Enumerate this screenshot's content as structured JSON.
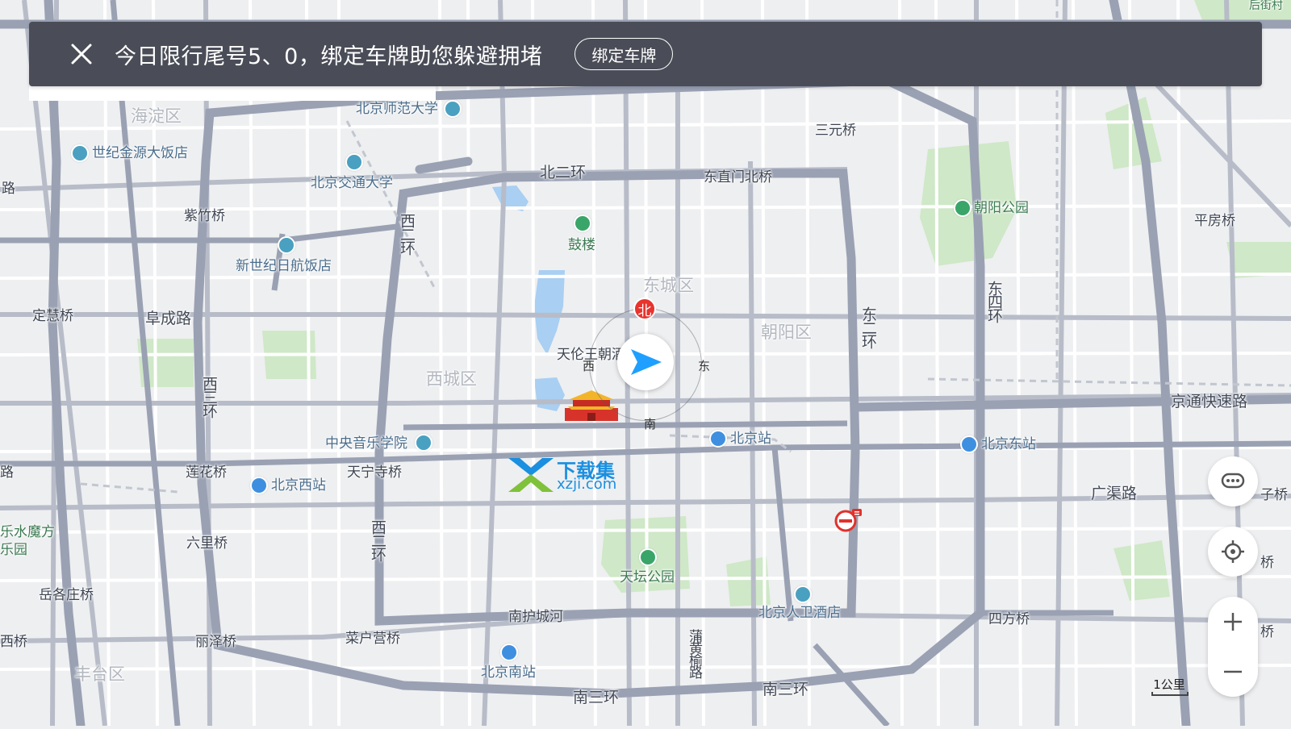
{
  "banner": {
    "message": "今日限行尾号5、0，绑定车牌助您躲避拥堵",
    "bind_button": "绑定车牌"
  },
  "compass": {
    "north": "北",
    "south": "南",
    "east": "东",
    "west": "西"
  },
  "scale": {
    "label": "1公里"
  },
  "watermark": {
    "text": "下载集",
    "domain": "xzji.com"
  },
  "colors": {
    "background": "#eeeff1",
    "road_major": "#9aa1b3",
    "road_minor": "#ffffff",
    "park": "#cfe8c7",
    "water": "#a9cff2",
    "banner": "#4a4d57",
    "navigation_arrow": "#1f9fff",
    "north_badge": "#e8342e"
  },
  "icons": [
    "close-icon",
    "chat-icon",
    "locate-icon",
    "zoom-in-icon",
    "zoom-out-icon",
    "navigation-arrow-icon",
    "tiananmen-icon",
    "no-entry-icon"
  ],
  "districts": [
    "海淀区",
    "东城区",
    "西城区",
    "朝阳区",
    "丰台区"
  ],
  "roads": {
    "bei_er_huan": "北二环",
    "dong_er_huan": "东二环",
    "xi_er_huan_n": "西二环",
    "xi_er_huan_s": "西二环",
    "xi_san_huan": "西三环",
    "dong_si_huan": "东四环",
    "nan_san_huan_l": "南三环",
    "nan_san_huan_r": "南三环",
    "fucheng_lu": "阜成路",
    "guangqu_lu": "广渠路",
    "jingtong": "京通快速路",
    "nanhucheng_he": "南护城河",
    "puhuang_yu": "蒲黄榆路",
    "lu_left": "路",
    "lu_left2": "路"
  },
  "bridges": {
    "sanyuan": "三元桥",
    "dongzhimen": "东直门北桥",
    "zizhu": "紫竹桥",
    "dinghui": "定慧桥",
    "lianhua": "莲花桥",
    "tianning": "天宁寺桥",
    "liuli": "六里桥",
    "yuegezhuang": "岳各庄桥",
    "lize": "丽泽桥",
    "caihuying": "菜户营桥",
    "sifang": "四方桥",
    "pingfang": "平房桥",
    "xi": "西桥",
    "qiao_right": "桥",
    "qiao_right2": "桥",
    "ziqiao_right": "子桥"
  },
  "pois": {
    "bnu": "北京师范大学",
    "shiji": "世纪金源大饭店",
    "bjtu": "北京交通大学",
    "xinshiji": "新世纪日航饭店",
    "gulou": "鼓楼",
    "tianlun": "天伦王朝酒",
    "chaoyang_park": "朝阳公园",
    "ccom": "中央音乐学院",
    "beijing_station": "北京站",
    "beijing_east": "北京东站",
    "beijing_west": "北京西站",
    "tiantan": "天坛公园",
    "renwei": "北京人卫酒店",
    "beijing_south": "北京南站",
    "lemo": "乐水魔方",
    "leyuan": "乐园",
    "topright": "后街村"
  }
}
